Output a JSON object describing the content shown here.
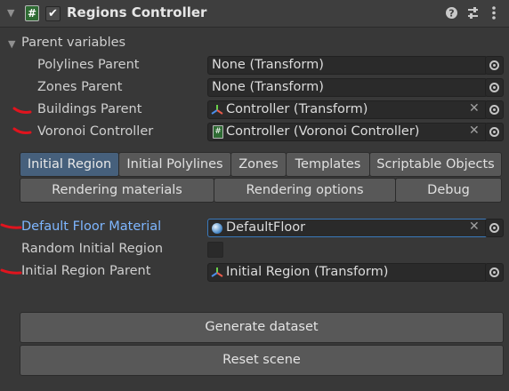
{
  "header": {
    "title": "Regions Controller",
    "enabled": true
  },
  "parent_section": {
    "title": "Parent variables",
    "fields": [
      {
        "label": "Polylines Parent",
        "value": "None (Transform)"
      },
      {
        "label": "Zones Parent",
        "value": "None (Transform)"
      },
      {
        "label": "Buildings Parent",
        "value": "Controller (Transform)"
      },
      {
        "label": "Voronoi Controller",
        "value": "Controller (Voronoi Controller)"
      }
    ]
  },
  "tabs_row1": [
    "Initial Region",
    "Initial Polylines",
    "Zones",
    "Templates",
    "Scriptable Objects"
  ],
  "tabs_row2": [
    "Rendering materials",
    "Rendering options",
    "Debug"
  ],
  "selected_tab": "Initial Region",
  "region_fields": {
    "default_floor_material": {
      "label": "Default Floor Material",
      "value": "DefaultFloor"
    },
    "random_initial_region": {
      "label": "Random Initial Region",
      "checked": false
    },
    "initial_region_parent": {
      "label": "Initial Region Parent",
      "value": "Initial Region (Transform)"
    }
  },
  "buttons": {
    "generate": "Generate dataset",
    "reset": "Reset scene"
  },
  "colors": {
    "accent_blue": "#7eb6ff",
    "selected_tab": "#46607c",
    "annotation_red": "#e0141e"
  }
}
